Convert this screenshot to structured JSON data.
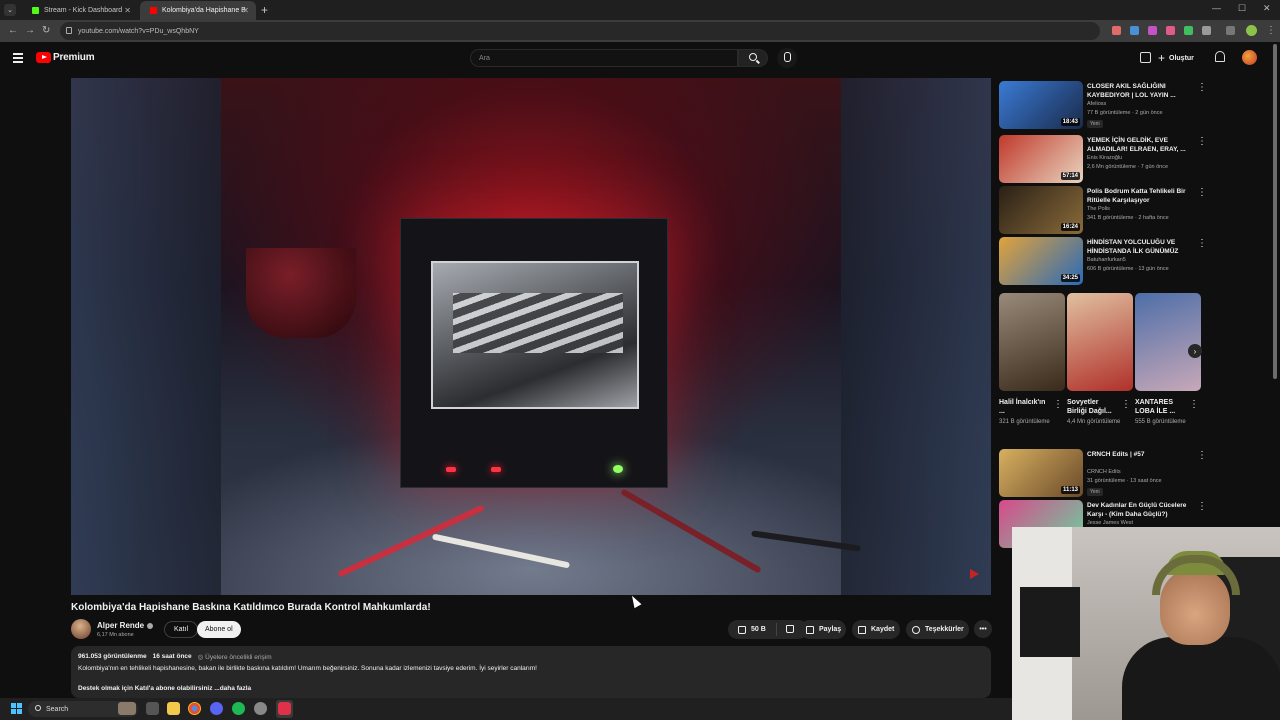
{
  "browser": {
    "tabs": [
      {
        "label": "Stream - Kick Dashboard",
        "favicon_color": "#53fc18"
      },
      {
        "label": "Kolombiya'da Hapishane B",
        "favicon_color": "#ff0000"
      }
    ],
    "url": "youtube.com/watch?v=PDu_wsQhbNY"
  },
  "youtube": {
    "brand": "Premium",
    "search_placeholder": "Ara",
    "create_label": "Oluştur"
  },
  "video": {
    "title": "Kolombiya'da Hapishane Baskına Katıldımco Burada Kontrol Mahkumlarda!",
    "channel": "Alper Rende",
    "subscribers": "6,17 Mn abone",
    "join_label": "Katıl",
    "subscribe_label": "Abone ol",
    "likes": "50 B",
    "share_label": "Paylaş",
    "save_label": "Kaydet",
    "thanks_label": "Teşekkürler",
    "views": "961.053 görüntülenme",
    "published": "16 saat önce",
    "members_badge": "Üyelere öncelikli erişim",
    "description": "Kolombiya'nın en tehlikeli hapishanesine, bakan ile birlikte baskına katıldım! Umarım beğenirsiniz. Sonuna kadar izlemenizi tavsiye ederim. İyi seyirler canlarım!",
    "support_text": "Destek olmak için Katıl'a abone olabilirsiniz",
    "more_label": "...daha fazla"
  },
  "recommendations": [
    {
      "title": "CLOSER AKIL SAĞLIĞINI KAYBEDIYOR | LOL YAYIN ...",
      "channel": "Afelioss",
      "meta": "77 B görüntüleme · 2 gün önce",
      "duration": "18:43",
      "badge": "Yeni",
      "thumb_color": "#3a7bd5"
    },
    {
      "title": "YEMEK İÇİN GELDİK, EVE ALMADILAR! ELRAEN, ERAY, ...",
      "channel": "Enis Kirazoğlu",
      "meta": "2,6 Mn görüntüleme · 7 gün önce",
      "duration": "57:14",
      "badge": "",
      "thumb_color": "#c0392b"
    },
    {
      "title": "Polis Bodrum Katta Tehlikeli Bir Ritüelle Karşılaşıyor",
      "channel": "The Polis",
      "meta": "341 B görüntüleme · 2 hafta önce",
      "duration": "16:24",
      "badge": "",
      "thumb_color": "#4a3b2a"
    },
    {
      "title": "HİNDİSTAN YOLCULUĞU VE HİNDİSTANDA İLK GÜNÜMÜZ",
      "channel": "Batuhanfurkan5",
      "meta": "606 B görüntüleme · 13 gün önce",
      "duration": "34:25",
      "badge": "",
      "thumb_color": "#e2a33a"
    },
    {
      "title": "CRNCH Edits | #57",
      "channel": "CRNCH Edits",
      "meta": "31 görüntüleme · 13 saat önce",
      "duration": "11:13",
      "badge": "Yeni",
      "thumb_color": "#d8b060"
    },
    {
      "title": "Dev Kadınlar En Güçlü Cücelere Karşı - (Kim Daha Güçlü?)",
      "channel": "Jesse James West",
      "meta": "",
      "duration": "",
      "badge": "",
      "thumb_color": "#d84a8a"
    }
  ],
  "shorts": [
    {
      "title": "Halil İnalcık'ın ...",
      "views": "321 B görüntüleme",
      "color": "#5a4a3a"
    },
    {
      "title": "Sovyetler Birliği Dağıl...",
      "views": "4,4 Mn görüntüleme",
      "color": "#b0302a"
    },
    {
      "title": "XANTARES LOBA İLE ...",
      "views": "555 B görüntüleme",
      "color": "#4d6ea8"
    }
  ],
  "taskbar": {
    "search_label": "Search"
  }
}
